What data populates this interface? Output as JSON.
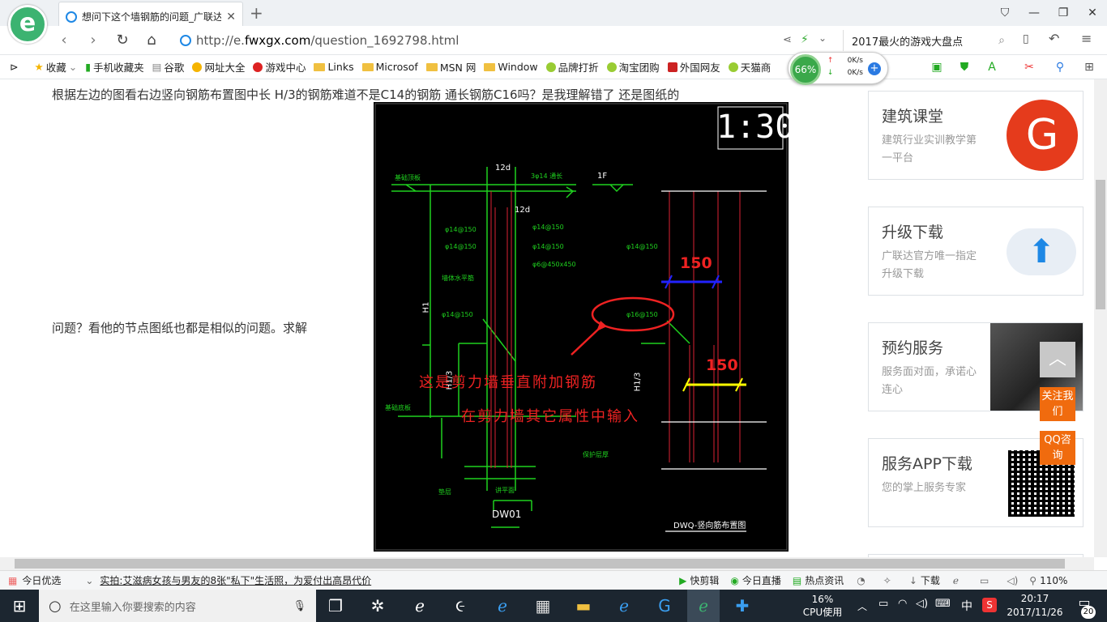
{
  "browser": {
    "tab_title": "想问下这个墙钢筋的问题_广联达",
    "url_scheme": "http://e.",
    "url_domain": "fwxgx.com",
    "url_path": "/question_1692798.html",
    "search_text": "2017最火的游戏大盘点",
    "speed_percent": "66%",
    "up_speed": "0K/s",
    "down_speed": "0K/s"
  },
  "bookmarks": [
    "收藏",
    "手机收藏夹",
    "谷歌",
    "网址大全",
    "游戏中心",
    "Links",
    "Microsof",
    "MSN 网",
    "Window",
    "品牌打折",
    "淘宝团购",
    "外国网友",
    "天猫商"
  ],
  "question": {
    "line1": "根据左边的图看右边竖向钢筋布置图中长 H/3的钢筋难道不是C14的钢筋 通长钢筋C16吗？是我理解错了 还是图纸的",
    "line2": "问题？看他的节点图纸也都是相似的问题。求解"
  },
  "cad": {
    "scale": "1:30",
    "dim_12d_a": "12d",
    "dim_12d_b": "12d",
    "label_1f": "1F",
    "label_top": "基础顶板",
    "label_rebar_a": "φ14@150",
    "label_rebar_b": "φ14@150",
    "label_rebar_c": "φ14@150",
    "label_rebar_d": "φ14@150",
    "label_rebar_e": "φ14@150",
    "label_rebar_f": "φ14@150",
    "label_rebar_g": "φ6@450x450",
    "label_rebar_h": "φ16@150",
    "label_stirrup": "3φ14 通长",
    "label_wall": "墙体水平筋",
    "label_h1": "H1",
    "label_h13a": "H1/3",
    "label_h13b": "H1/3",
    "label_base": "基础底板",
    "label_pad": "垫层",
    "label_cover": "保护层厚",
    "label_flat": "讲平面",
    "label_dw": "DW01",
    "label_dwq": "DWQ-竖向筋布置图",
    "dim_150_blue": "150",
    "dim_150_yellow": "150",
    "annot1": "这是剪力墙垂直附加钢筋",
    "annot2": "在剪力墙其它属性中输入"
  },
  "sidebar": {
    "cards": [
      {
        "title": "建筑课堂",
        "desc": "建筑行业实训教学第一平台"
      },
      {
        "title": "升级下载",
        "desc": "广联达官方唯一指定升级下载"
      },
      {
        "title": "预约服务",
        "desc": "服务面对面，承诺心连心"
      },
      {
        "title": "服务APP下载",
        "desc": "您的掌上服务专家"
      }
    ],
    "follow": "关注我们",
    "qq": "QQ咨询"
  },
  "status": {
    "today": "今日优选",
    "news": "实拍:艾滋病女孩与男友的8张\"私下\"生活照，为爱付出高昂代价",
    "kuaijianji": "快剪辑",
    "live": "今日直播",
    "hot": "热点资讯",
    "download": "下载",
    "zoom": "110%"
  },
  "taskbar": {
    "search_placeholder": "在这里输入你要搜索的内容",
    "cpu": "16%",
    "cpu_label": "CPU使用",
    "ime": "中",
    "time": "20:17",
    "date": "2017/11/26",
    "notif": "20"
  }
}
